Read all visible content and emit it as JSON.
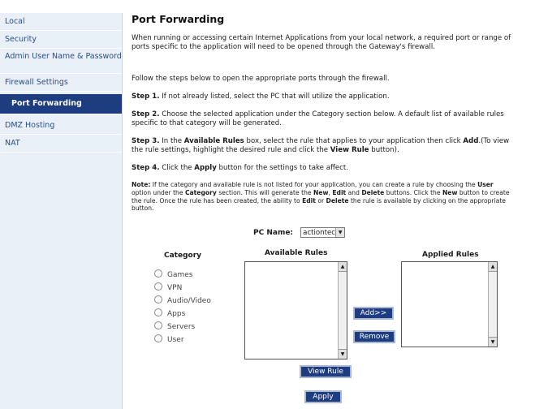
{
  "sidebar": {
    "items": [
      {
        "label": "Local"
      },
      {
        "label": "Security"
      },
      {
        "label": "Admin User Name & Password"
      },
      {
        "label": "Firewall Settings"
      },
      {
        "label": "Port Forwarding"
      },
      {
        "label": "DMZ Hosting"
      },
      {
        "label": "NAT"
      }
    ],
    "active_index": 4
  },
  "page": {
    "title": "Port Forwarding",
    "intro": "When running or accessing certain Internet Applications from your local network, a required port or range of ports specific to the application will need to be opened through the Gateway's firewall.",
    "follow": "Follow the steps below to open the appropriate ports through the firewall.",
    "step1_label": "Step 1.",
    "step1_text": " If not already listed, select the PC that will utilize the application.",
    "step2_label": "Step 2.",
    "step2_text": " Choose the selected application under the Category section below. A default list of available rules specific to that category will be generated.",
    "step3_label": "Step 3.",
    "step3_a": " In the ",
    "step3_b": "Available Rules",
    "step3_c": " box, select the rule that applies to your application then click ",
    "step3_d": "Add",
    "step3_e": ".(To view the rule settings, highlight the desired rule and click the ",
    "step3_f": "View Rule",
    "step3_g": " button).",
    "step4_label": "Step 4.",
    "step4_a": " Click the ",
    "step4_b": "Apply",
    "step4_c": " button for the settings to take affect.",
    "note_label": "Note:",
    "note_a": " If the category and available rule is not listed for your application, you can create a rule by choosing the ",
    "note_b": "User",
    "note_c": " option under the ",
    "note_d": "Category",
    "note_e": " section. This will generate the ",
    "note_f": "New",
    "note_g": ", ",
    "note_h": "Edit",
    "note_i": " and ",
    "note_j": "Delete",
    "note_k": " buttons. Click the ",
    "note_l": "New",
    "note_m": " button to create the rule. Once the rule has been created, the ability to ",
    "note_n": "Edit",
    "note_o": " or ",
    "note_p": "Delete",
    "note_q": " the rule is available by clicking on the appropriate button."
  },
  "form": {
    "pc_name_label": "PC Name:",
    "pc_name_value": "actiontec",
    "category_header": "Category",
    "available_header": "Available Rules",
    "applied_header": "Applied Rules",
    "categories": [
      "Games",
      "VPN",
      "Audio/Video",
      "Apps",
      "Servers",
      "User"
    ],
    "add_label": "Add>>",
    "remove_label": "Remove",
    "view_rule_label": "View Rule",
    "apply_label": "Apply"
  },
  "colors": {
    "accent": "#1e3c80",
    "sidebar_bg": "#eaf0f8",
    "sidebar_text": "#2c4c88"
  }
}
